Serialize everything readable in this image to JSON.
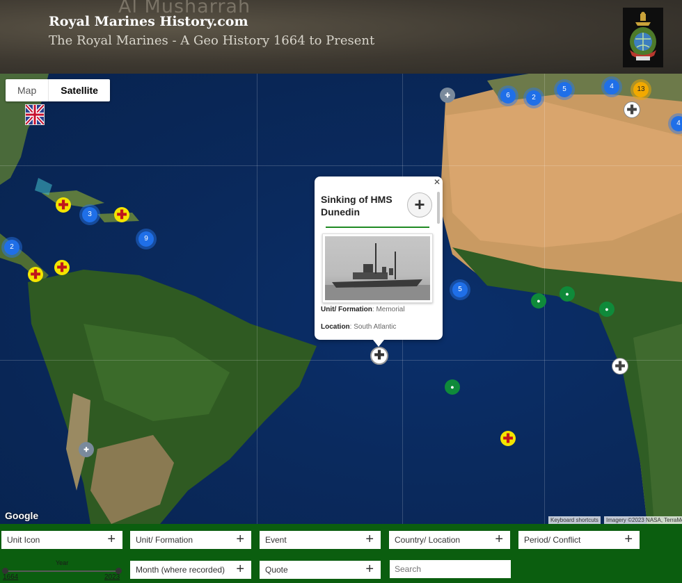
{
  "header": {
    "background_place_label": "Al Musharrah",
    "title": "Royal Marines History.com",
    "subtitle": "The Royal Marines - A Geo History 1664 to Present",
    "crest_icon": "royal-marines-crest-icon"
  },
  "map": {
    "type_control": {
      "map_label": "Map",
      "satellite_label": "Satellite",
      "selected": "Satellite"
    },
    "google_logo": "Google",
    "attribution": {
      "shortcuts": "Keyboard shortcuts",
      "imagery": "Imagery ©2023 NASA, TerraMe"
    },
    "clusters": [
      {
        "count": "6",
        "color": "#1f6fe8"
      },
      {
        "count": "2",
        "color": "#1f6fe8"
      },
      {
        "count": "5",
        "color": "#1f6fe8"
      },
      {
        "count": "4",
        "color": "#1f6fe8"
      },
      {
        "count": "13",
        "color": "#f2a900"
      },
      {
        "count": "4",
        "color": "#1f6fe8"
      },
      {
        "count": "3",
        "color": "#1f6fe8"
      },
      {
        "count": "9",
        "color": "#1f6fe8"
      },
      {
        "count": "2",
        "color": "#1f6fe8"
      },
      {
        "count": "5",
        "color": "#1f6fe8"
      }
    ]
  },
  "popup": {
    "title": "Sinking of HMS Dunedin",
    "close_icon": "close-icon",
    "unit_formation_label": "Unit/ Formation",
    "unit_formation_value": "Memorial",
    "location_label": "Location",
    "location_value": "South Atlantic"
  },
  "filters": {
    "unit_icon": "Unit Icon",
    "unit_formation": "Unit/ Formation",
    "event": "Event",
    "country_location": "Country/ Location",
    "period_conflict": "Period/ Conflict",
    "month": "Month (where recorded)",
    "quote": "Quote",
    "search_placeholder": "Search",
    "year": {
      "label": "Year",
      "min": "1664",
      "max": "2023"
    }
  }
}
